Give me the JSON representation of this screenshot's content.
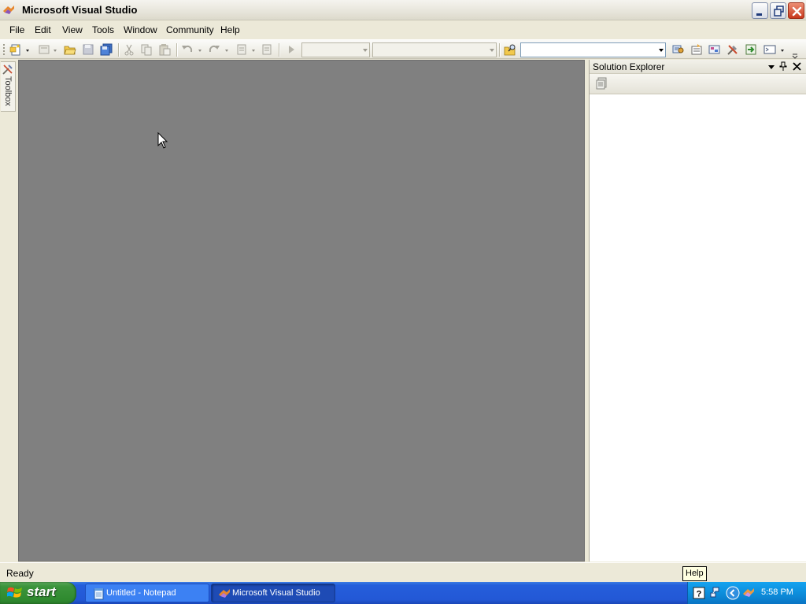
{
  "window": {
    "title": "Microsoft Visual Studio"
  },
  "menu": {
    "items": [
      "File",
      "Edit",
      "View",
      "Tools",
      "Window",
      "Community",
      "Help"
    ]
  },
  "toolbar": {
    "find_value": ""
  },
  "toolbox": {
    "label": "Toolbox"
  },
  "solution_explorer": {
    "title": "Solution Explorer"
  },
  "status": {
    "text": "Ready",
    "tooltip": "Help"
  },
  "taskbar": {
    "start_label": "start",
    "tasks": [
      {
        "label": "Untitled - Notepad"
      },
      {
        "label": "Microsoft Visual Studio"
      }
    ],
    "clock": "5:58 PM"
  },
  "colors": {
    "editor_background": "#808080",
    "taskbar_blue": "#245edb",
    "start_green": "#3c943c"
  }
}
